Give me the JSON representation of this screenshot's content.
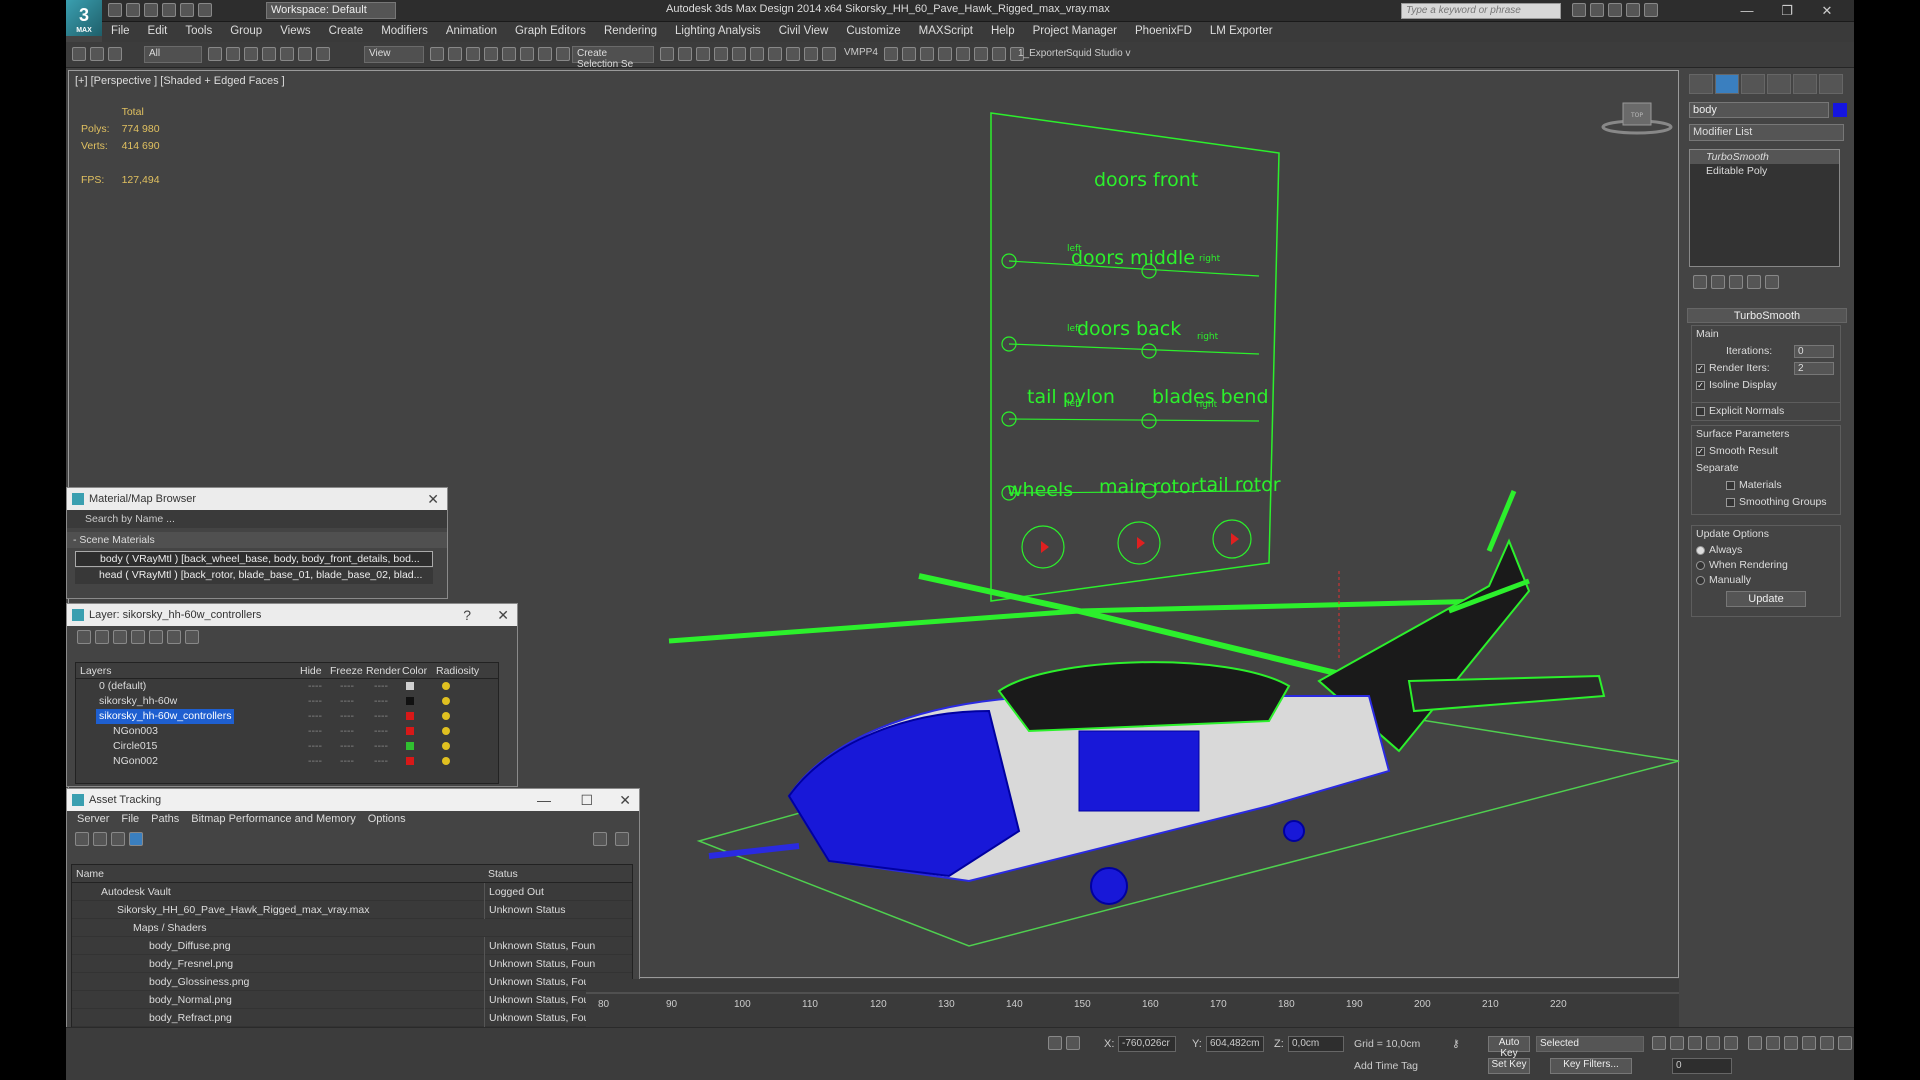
{
  "app": {
    "logo": "3",
    "logo_sub": "MAX",
    "workspace": "Workspace: Default",
    "title": "Autodesk 3ds Max Design 2014 x64    Sikorsky_HH_60_Pave_Hawk_Rigged_max_vray.max",
    "search_placeholder": "Type a keyword or phrase"
  },
  "menu": [
    "File",
    "Edit",
    "Tools",
    "Group",
    "Views",
    "Create",
    "Modifiers",
    "Animation",
    "Graph Editors",
    "Rendering",
    "Lighting Analysis",
    "Civil View",
    "Customize",
    "MAXScript",
    "Help",
    "Project Manager",
    "PhoenixFD",
    "LM Exporter"
  ],
  "toolbar": {
    "filter": "All",
    "ref_coord": "View",
    "selection_set": "Create Selection Se",
    "vmpp": "VMPP4",
    "exporter": "1_Exporter",
    "squid": "Squid Studio v"
  },
  "viewport": {
    "label": "[+] [Perspective ] [Shaded + Edged Faces ]",
    "stats_header": "Total",
    "polys_label": "Polys:",
    "polys_value": "774 980",
    "verts_label": "Verts:",
    "verts_value": "414 690",
    "fps_label": "FPS:",
    "fps_value": "127,494",
    "viewcube_label": "TOP"
  },
  "rig": {
    "doors_front": "doors  front",
    "doors_middle": "doors middle",
    "doors_back": "doors back",
    "tail_pylon": "tail pylon",
    "blades_bend": "blades bend",
    "wheels": "wheels",
    "main_rotor": "main rotor",
    "tail_rotor": "tail rotor",
    "left": "left",
    "right": "right"
  },
  "cmdpanel": {
    "object_name": "body",
    "modifier_list": "Modifier List",
    "stack": [
      "TurboSmooth",
      "Editable Poly"
    ],
    "rollout_title": "TurboSmooth",
    "main_label": "Main",
    "iterations_label": "Iterations:",
    "iterations_value": "0",
    "render_iters_label": "Render Iters:",
    "render_iters_value": "2",
    "isoline_label": "Isoline Display",
    "explicit_label": "Explicit Normals",
    "surface_label": "Surface Parameters",
    "smooth_result_label": "Smooth Result",
    "separate_label": "Separate",
    "materials_label": "Materials",
    "smoothing_groups_label": "Smoothing Groups",
    "update_options_label": "Update Options",
    "always_label": "Always",
    "when_rendering_label": "When Rendering",
    "manually_label": "Manually",
    "update_button": "Update"
  },
  "material_browser": {
    "title": "Material/Map Browser",
    "search": "Search by Name ...",
    "section": "- Scene Materials",
    "items": [
      "body ( VRayMtl ) [back_wheel_base, body, body_front_details, bod...",
      "head ( VRayMtl ) [back_rotor, blade_base_01, blade_base_02, blad..."
    ]
  },
  "layer_dialog": {
    "title": "Layer: sikorsky_hh-60w_controllers",
    "help": "?",
    "columns": [
      "Layers",
      "Hide",
      "Freeze",
      "Render",
      "Color",
      "Radiosity"
    ],
    "rows": [
      {
        "name": "0 (default)",
        "color": "#d0d0d0",
        "indent": 1
      },
      {
        "name": "sikorsky_hh-60w",
        "color": "#111111",
        "indent": 1
      },
      {
        "name": "sikorsky_hh-60w_controllers",
        "color": "#d81818",
        "indent": 1,
        "selected": true
      },
      {
        "name": "NGon003",
        "color": "#d81818",
        "indent": 2
      },
      {
        "name": "Circle015",
        "color": "#30c030",
        "indent": 2
      },
      {
        "name": "NGon002",
        "color": "#d81818",
        "indent": 2
      }
    ]
  },
  "asset_tracking": {
    "title": "Asset Tracking",
    "menu": [
      "Server",
      "File",
      "Paths",
      "Bitmap Performance and Memory",
      "Options"
    ],
    "columns": [
      "Name",
      "Status"
    ],
    "rows": [
      {
        "name": "Autodesk Vault",
        "status": "Logged Out",
        "indent": 1
      },
      {
        "name": "Sikorsky_HH_60_Pave_Hawk_Rigged_max_vray.max",
        "status": "Unknown Status",
        "indent": 2
      },
      {
        "name": "Maps / Shaders",
        "status": "",
        "indent": 3
      },
      {
        "name": "body_Diffuse.png",
        "status": "Unknown Status, Foun",
        "indent": 4
      },
      {
        "name": "body_Fresnel.png",
        "status": "Unknown Status, Foun",
        "indent": 4
      },
      {
        "name": "body_Glossiness.png",
        "status": "Unknown Status, Foun",
        "indent": 4
      },
      {
        "name": "body_Normal.png",
        "status": "Unknown Status, Foun",
        "indent": 4
      },
      {
        "name": "body_Refract.png",
        "status": "Unknown Status, Foun",
        "indent": 4
      }
    ]
  },
  "timeline": {
    "ticks": [
      "80",
      "90",
      "100",
      "110",
      "120",
      "130",
      "140",
      "150",
      "160",
      "170",
      "180",
      "190",
      "200",
      "210",
      "220"
    ]
  },
  "status": {
    "x_label": "X:",
    "x_value": "-760,026cr",
    "y_label": "Y:",
    "y_value": "604,482cm",
    "z_label": "Z:",
    "z_value": "0,0cm",
    "grid": "Grid = 10,0cm",
    "auto_key": "Auto Key",
    "selected": "Selected",
    "set_key": "Set Key",
    "key_filters": "Key Filters...",
    "add_time_tag": "Add Time Tag",
    "frame": "0"
  },
  "colors": {
    "accent": "#3a9fb0",
    "selection_blue": "#1e5fd0",
    "wire_green": "#2cf02c",
    "body_blue": "#1515e0"
  }
}
